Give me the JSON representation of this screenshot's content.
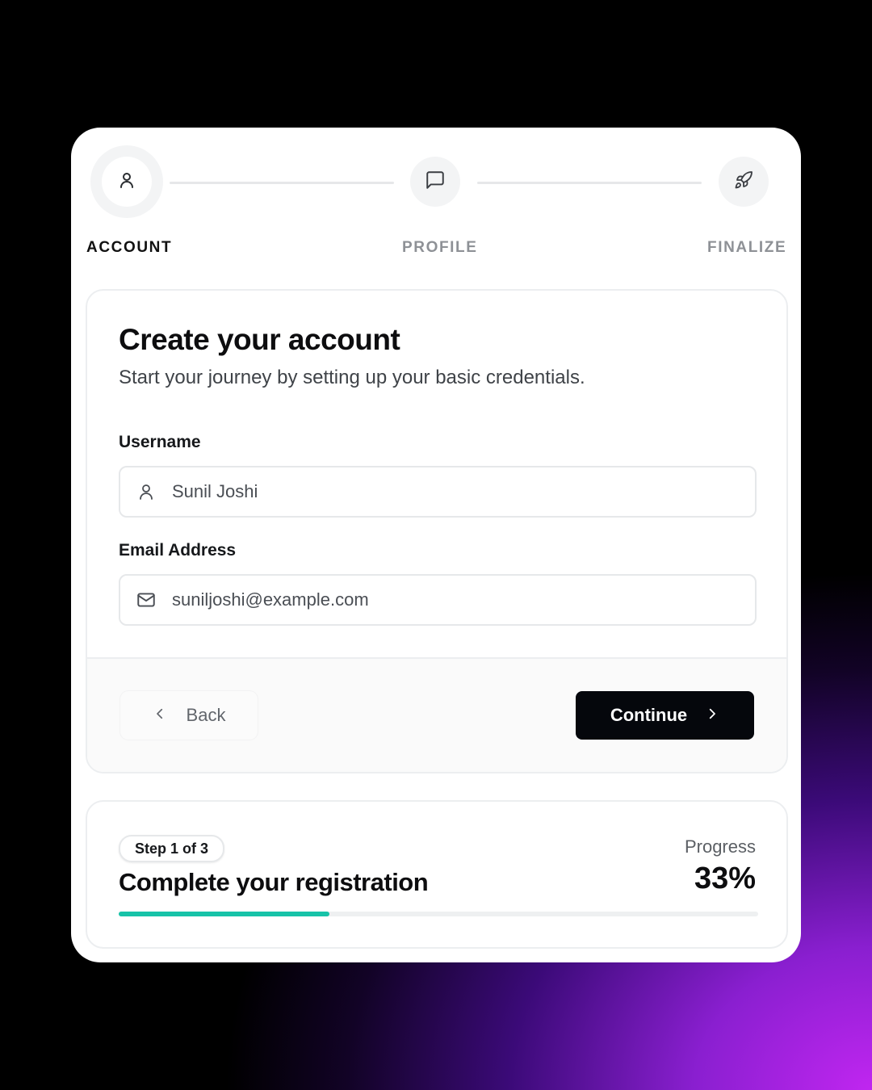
{
  "stepper": {
    "steps": [
      {
        "label": "ACCOUNT",
        "icon": "user-icon",
        "state": "active"
      },
      {
        "label": "PROFILE",
        "icon": "message-square-icon",
        "state": "upcoming"
      },
      {
        "label": "FINALIZE",
        "icon": "rocket-icon",
        "state": "upcoming"
      }
    ]
  },
  "form": {
    "title": "Create your account",
    "subtitle": "Start your journey by setting up your basic credentials.",
    "username": {
      "label": "Username",
      "value": "Sunil Joshi",
      "icon": "user-icon"
    },
    "email": {
      "label": "Email Address",
      "value": "suniljoshi@example.com",
      "icon": "mail-icon"
    }
  },
  "actions": {
    "back_label": "Back",
    "continue_label": "Continue"
  },
  "progress": {
    "step_badge": "Step 1 of 3",
    "title": "Complete your registration",
    "label": "Progress",
    "value_text": "33%",
    "fraction": 0.33
  },
  "colors": {
    "accent": "#17c3a8",
    "primary_button": "#05070c",
    "active_text": "#111111",
    "inactive_text": "#8e9196"
  }
}
